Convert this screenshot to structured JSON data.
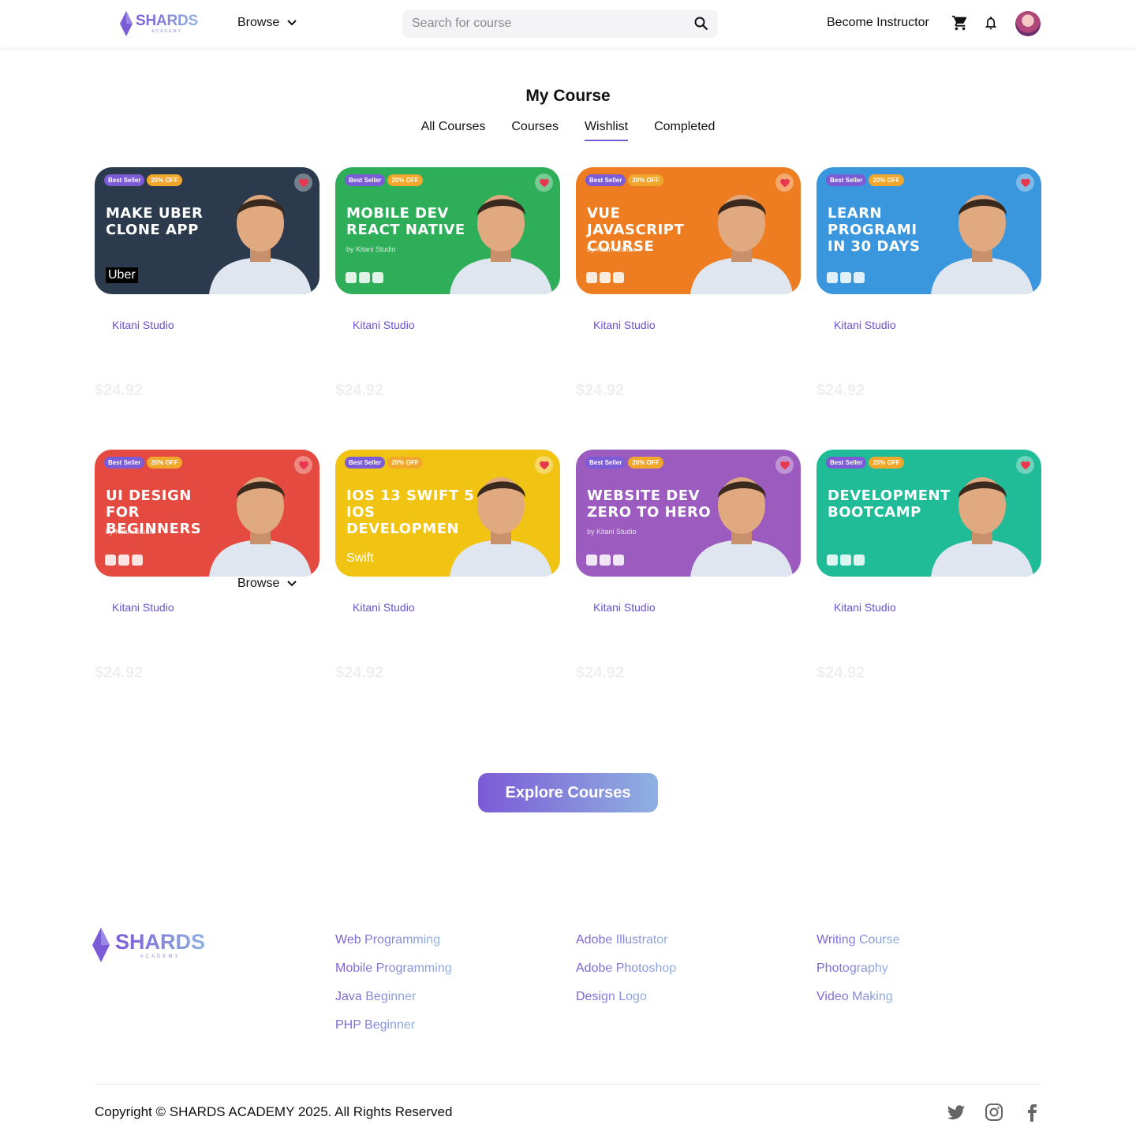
{
  "header": {
    "logo_text": "SHARDS",
    "logo_sub": "ACADEMY",
    "browse_label": "Browse",
    "search_placeholder": "Search for course",
    "become_instructor": "Become Instructor"
  },
  "page": {
    "title": "My Course",
    "tabs": [
      "All Courses",
      "Courses",
      "Wishlist",
      "Completed"
    ],
    "active_tab": "Wishlist"
  },
  "badges": {
    "seller": "Best Seller",
    "discount": "20% OFF"
  },
  "courses": [
    {
      "title": "MAKE UBER\nCLONE APP",
      "by": "",
      "brand": "Uber",
      "bg": "#2c3a4e",
      "author": "Kitani Studio",
      "price": "$24.92"
    },
    {
      "title": "MOBILE DEV\nREACT NATIVE",
      "by": "by Kitani Studio",
      "brand": "",
      "bg": "#2fae5a",
      "author": "Kitani Studio",
      "price": "$24.92"
    },
    {
      "title": "VUE JAVASCRIPT\nCOURSE",
      "by": "by Kitani Studio",
      "brand": "",
      "bg": "#ee7d22",
      "author": "Kitani Studio",
      "price": "$24.92"
    },
    {
      "title": "LEARN PROGRAMI\nIN 30 DAYS",
      "by": "",
      "brand": "",
      "bg": "#3a97de",
      "author": "Kitani Studio",
      "price": "$24.92"
    },
    {
      "title": "UI DESIGN\nFOR BEGINNERS",
      "by": "by Kitani Studio",
      "brand": "",
      "bg": "#e44a40",
      "author": "Kitani Studio",
      "price": "$24.92"
    },
    {
      "title": "IOS 13 SWIFT 5\nIOS DEVELOPMEN",
      "by": "",
      "brand": "Swift",
      "bg": "#f1c414",
      "author": "Kitani Studio",
      "price": "$24.92"
    },
    {
      "title": "WEBSITE DEV\nZERO TO HERO",
      "by": "by Kitani Studio",
      "brand": "",
      "bg": "#9b5bbf",
      "author": "Kitani Studio",
      "price": "$24.92"
    },
    {
      "title": "DEVELOPMENT\nBOOTCAMP",
      "by": "",
      "brand": "",
      "bg": "#1fbc97",
      "author": "Kitani Studio",
      "price": "$24.92"
    }
  ],
  "browse_overlay_label": "Browse",
  "explore_label": "Explore Courses",
  "footer": {
    "logo_text": "SHARDS",
    "logo_sub": "ACADEMY",
    "col1": [
      "Web Programming",
      "Mobile Programming",
      "Java Beginner",
      "PHP Beginner"
    ],
    "col2": [
      "Adobe Illustrator",
      "Adobe Photoshop",
      "Design Logo"
    ],
    "col3": [
      "Writing Course",
      "Photography",
      "Video Making"
    ],
    "copyright": "Copyright © SHARDS ACADEMY 2025. All Rights Reserved"
  },
  "colors": {
    "accent": "#7b5bd6",
    "accent_light": "#8fb1e0",
    "heart": "#e8384f",
    "discount": "#f0a72c"
  },
  "icons": [
    "search-icon",
    "cart-icon",
    "bell-icon",
    "chevron-down-icon",
    "heart-icon",
    "twitter-icon",
    "instagram-icon",
    "facebook-icon"
  ]
}
